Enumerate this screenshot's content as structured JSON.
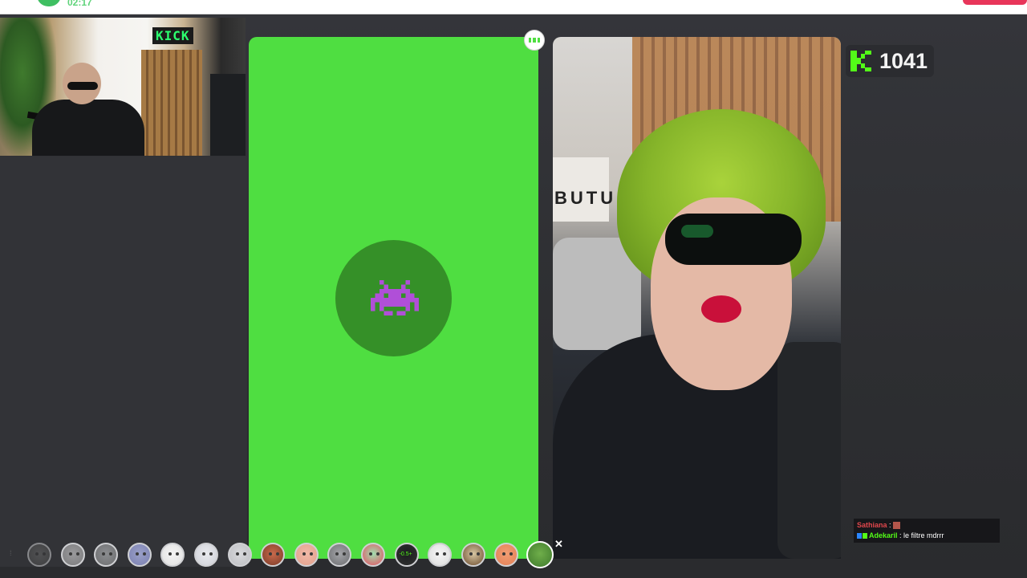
{
  "top_bar": {
    "timer": "02:17"
  },
  "streamer_cam": {
    "sign_text": "KICK"
  },
  "video_partner": {
    "shelf_text": "BUTU"
  },
  "viewer_counter": {
    "count": "1041",
    "icon": "kick-logo-icon"
  },
  "colors": {
    "green_panel": "#4fde41",
    "kick_green": "#53fc18",
    "invader_purple": "#b04fd8"
  },
  "chat": [
    {
      "user": "Sathiana",
      "separator": " : ",
      "message": "",
      "has_emote": true
    },
    {
      "user": "Adekaril",
      "separator": " : ",
      "message": "le filtre mdrrr",
      "has_emote": false
    }
  ],
  "filter_tray": {
    "filters": [
      {
        "name": "gorilla",
        "icon": "gorilla-filter-icon",
        "selected": false
      },
      {
        "name": "cat",
        "icon": "cat-filter-icon",
        "selected": false
      },
      {
        "name": "donkey",
        "icon": "donkey-filter-icon",
        "selected": false
      },
      {
        "name": "galaxy",
        "icon": "galaxy-filter-icon",
        "selected": false
      },
      {
        "name": "pig",
        "icon": "pig-filter-icon",
        "selected": false
      },
      {
        "name": "ghost",
        "icon": "ghost-filter-icon",
        "selected": false
      },
      {
        "name": "sad-face",
        "icon": "sad-face-filter-icon",
        "selected": false
      },
      {
        "name": "man-face",
        "icon": "man-face-filter-icon",
        "selected": false
      },
      {
        "name": "blush",
        "icon": "blush-filter-icon",
        "selected": false
      },
      {
        "name": "mouse",
        "icon": "mouse-filter-icon",
        "selected": false
      },
      {
        "name": "zombie",
        "icon": "zombie-filter-icon",
        "selected": false
      },
      {
        "name": "speed",
        "icon": "speed-filter-icon",
        "selected": false
      },
      {
        "name": "panda",
        "icon": "panda-filter-icon",
        "selected": false
      },
      {
        "name": "mustache",
        "icon": "mustache-filter-icon",
        "selected": false
      },
      {
        "name": "orange",
        "icon": "orange-filter-icon",
        "selected": false
      },
      {
        "name": "green-hair",
        "icon": "green-hair-filter-icon",
        "selected": true
      }
    ],
    "speed_label": "-0.5+"
  }
}
